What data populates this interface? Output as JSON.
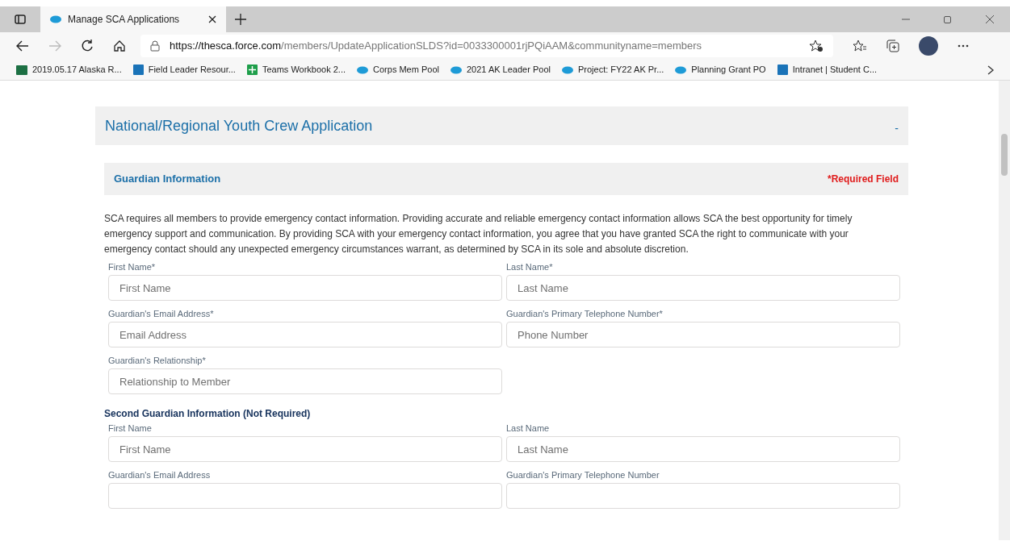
{
  "browser": {
    "tab_title": "Manage SCA Applications",
    "url_host": "https://thesca.force.com",
    "url_path": "/members/UpdateApplicationSLDS?id=0033300001rjPQiAAM&communityname=members",
    "bookmarks": [
      {
        "label": "2019.05.17 Alaska R...",
        "kind": "sheet"
      },
      {
        "label": "Field Leader Resour...",
        "kind": "sharepoint"
      },
      {
        "label": "Teams Workbook 2...",
        "kind": "plus"
      },
      {
        "label": "Corps Mem Pool",
        "kind": "cloud"
      },
      {
        "label": "2021 AK Leader Pool",
        "kind": "cloud"
      },
      {
        "label": "Project: FY22 AK Pr...",
        "kind": "cloud"
      },
      {
        "label": "Planning Grant PO",
        "kind": "cloud"
      },
      {
        "label": "Intranet | Student C...",
        "kind": "sharepoint"
      }
    ]
  },
  "application": {
    "title": "National/Regional Youth Crew Application",
    "collapse": "-",
    "section": {
      "title": "Guardian Information",
      "required_note": "*Required Field"
    },
    "intro": "SCA requires all members to provide emergency contact information. Providing accurate and reliable emergency contact information allows SCA the best opportunity for timely emergency support and communication. By providing SCA with your emergency contact information, you agree that you have granted SCA the right to communicate with your emergency contact should any unexpected emergency circumstances warrant, as determined by SCA in its sole and absolute discretion.",
    "guardian_fields": [
      {
        "label": "First Name*",
        "placeholder": "First Name"
      },
      {
        "label": "Last Name*",
        "placeholder": "Last Name"
      },
      {
        "label": "Guardian's Email Address*",
        "placeholder": "Email Address"
      },
      {
        "label": "Guardian's Primary Telephone Number*",
        "placeholder": "Phone Number"
      },
      {
        "label": "Guardian's Relationship*",
        "placeholder": "Relationship to Member"
      }
    ],
    "second_title": "Second Guardian Information (Not Required)",
    "second_fields": [
      {
        "label": "First Name",
        "placeholder": "First Name"
      },
      {
        "label": "Last Name",
        "placeholder": "Last Name"
      },
      {
        "label": "Guardian's Email Address"
      },
      {
        "label": "Guardian's Primary Telephone Number"
      }
    ]
  }
}
